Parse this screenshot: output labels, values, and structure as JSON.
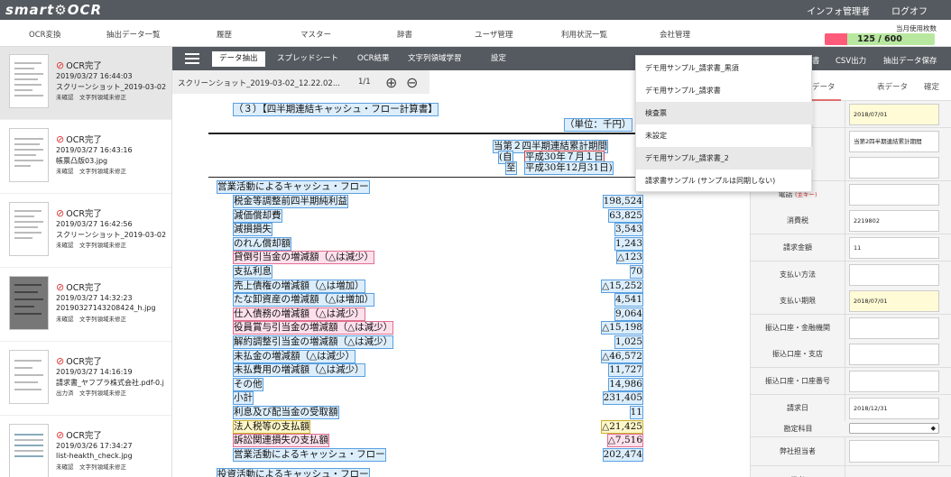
{
  "brand": {
    "name_left": "smart",
    "name_right": "OCR"
  },
  "top_links": [
    "インフォ管理者",
    "ログオフ"
  ],
  "nav": [
    "OCR変換",
    "抽出データ一覧",
    "履歴",
    "マスター",
    "辞書",
    "ユーザ管理",
    "利用状況一覧",
    "会社管理"
  ],
  "usage": {
    "label": "当月使用枚数",
    "text": "125 / 600",
    "fraction": 0.2083,
    "fill_color": "#ff5a7a",
    "bg_color": "#b8e8a0"
  },
  "files": [
    {
      "status": "OCR完了",
      "time": "2019/03/27 16:44:03",
      "name": "スクリーンショット_2019-03-02",
      "flags": "未確認　文字列領域未修正",
      "selected": true
    },
    {
      "status": "OCR完了",
      "time": "2019/03/27 16:43:16",
      "name": "帳票凸版03.jpg",
      "flags": "未確認　文字列領域未修正"
    },
    {
      "status": "OCR完了",
      "time": "2019/03/27 16:42:56",
      "name": "スクリーンショット_2019-03-02",
      "flags": "未確認　文字列領域未修正"
    },
    {
      "status": "OCR完了",
      "time": "2019/03/27 14:32:23",
      "name": "20190327143208424_h.jpg",
      "flags": "未確認　文字列領域未修正"
    },
    {
      "status": "OCR完了",
      "time": "2019/03/27 14:16:19",
      "name": "請求書_ヤフプラ株式会社.pdf-0.j",
      "flags": "出力済　文字列領域未修正"
    },
    {
      "status": "OCR完了",
      "time": "2019/03/26 17:34:27",
      "name": "list-heakth_check.jpg",
      "flags": "未確認　文字列領域未修正"
    }
  ],
  "toolbar": {
    "tabs": [
      "データ抽出",
      "スプレッドシート",
      "OCR結果",
      "文字列領域学習",
      "設定"
    ],
    "right_buttons": [
      "書",
      "CSV出力",
      "抽出データ保存"
    ]
  },
  "viewer": {
    "filename": "スクリーンショット_2019-03-02_12.22.02...",
    "page": "1/1"
  },
  "document": {
    "heading": "（３）【四半期連結キャッシュ・フロー計算書】",
    "unit": "（単位：千円）",
    "period_title": "当第２四半期連結累計期間",
    "period_from_label": "(自",
    "period_from": "平成30年７月１日",
    "period_to_label": "至",
    "period_to": "平成30年12月31日)",
    "section": "営業活動によるキャッシュ・フロー",
    "rows": [
      {
        "label": "税金等調整前四半期純利益",
        "value": "198,524",
        "style": "hl"
      },
      {
        "label": "減価償却費",
        "value": "63,825",
        "style": "hl"
      },
      {
        "label": "減損損失",
        "value": "3,543",
        "style": "hl"
      },
      {
        "label": "のれん償却額",
        "value": "1,243",
        "style": "hl"
      },
      {
        "label": "貸倒引当金の増減額（△は減少）",
        "value": "△123",
        "style": "hlp"
      },
      {
        "label": "支払利息",
        "value": "70",
        "style": "hl"
      },
      {
        "label": "売上債権の増減額（△は増加）",
        "value": "△15,252",
        "style": "hl"
      },
      {
        "label": "たな卸資産の増減額（△は増加）",
        "value": "4,541",
        "style": "hl"
      },
      {
        "label": "仕入債務の増減額（△は減少）",
        "value": "9,064",
        "style": "hlp"
      },
      {
        "label": "役員賞与引当金の増減額（△は減少）",
        "value": "△15,198",
        "style": "hlp"
      },
      {
        "label": "解約調整引当金の増減額（△は減少）",
        "value": "1,025",
        "style": "hl"
      },
      {
        "label": "未払金の増減額（△は減少）",
        "value": "△46,572",
        "style": "hl"
      },
      {
        "label": "未払費用の増減額（△は減少）",
        "value": "11,727",
        "style": "hl"
      },
      {
        "label": "その他",
        "value": "14,986",
        "style": "hl"
      },
      {
        "label": "小計",
        "value": "231,405",
        "style": "hl"
      },
      {
        "label": "利息及び配当金の受取額",
        "value": "11",
        "style": "hl"
      },
      {
        "label": "法人税等の支払額",
        "value": "△21,425",
        "style": "hly"
      },
      {
        "label": "訴訟関連損失の支払額",
        "value": "△7,516",
        "style": "hlp"
      },
      {
        "label": "営業活動によるキャッシュ・フロー",
        "value": "202,474",
        "style": "hl"
      }
    ],
    "cut_off": "投資活動によるキャッシュ・フロー"
  },
  "right_panel": {
    "tabs": [
      "データ",
      "表データ",
      "確定"
    ],
    "fields": [
      {
        "label": "",
        "value": "2018/07/01",
        "yellow": true
      },
      {
        "label": "",
        "value": "当第2四半期連結累計期間",
        "yellow": false
      },
      {
        "label": "",
        "value": "",
        "yellow": false
      },
      {
        "label": "電話",
        "req": "(主キー)",
        "value": "",
        "yellow": false
      },
      {
        "label": "消費税",
        "value": "2219802",
        "yellow": false
      },
      {
        "label": "請求金額",
        "value": "11",
        "yellow": false
      },
      {
        "label": "支払い方法",
        "value": "",
        "yellow": false
      },
      {
        "label": "支払い期限",
        "value": "2018/07/01",
        "yellow": true
      },
      {
        "label": "振込口座・金融機関",
        "value": "",
        "yellow": false
      },
      {
        "label": "振込口座・支店",
        "value": "",
        "yellow": false
      },
      {
        "label": "振込口座・口座番号",
        "value": "",
        "yellow": false
      },
      {
        "label": "請求日",
        "value": "2018/12/31",
        "yellow": false
      }
    ],
    "account_label": "勘定科目",
    "account_select": "◆",
    "person_label": "弊社担当者",
    "note_label": "備考"
  },
  "dropdown": {
    "items": [
      "デモ用サンプル_請求書_黒須",
      "デモ用サンプル_請求書",
      "検査票",
      "未設定",
      "デモ用サンプル_請求書_2",
      "請求書サンプル (サンプルは同期しない)"
    ],
    "hover_indices": [
      2,
      4
    ]
  }
}
